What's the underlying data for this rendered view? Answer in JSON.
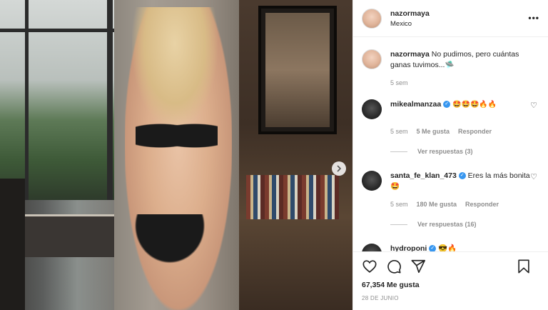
{
  "post": {
    "username": "nazormaya",
    "location": "Mexico",
    "more_label": "•••"
  },
  "caption": {
    "username": "nazormaya",
    "text": "No pudimos, pero cuántas ganas tuvimos...🛸",
    "time": "5 sem"
  },
  "comments": [
    {
      "username": "mikealmanzaa",
      "verified": true,
      "text": "🤩🤩🤩🔥🔥",
      "time": "5 sem",
      "likes": "5 Me gusta",
      "reply_label": "Responder",
      "view_replies": "Ver respuestas (3)"
    },
    {
      "username": "santa_fe_klan_473",
      "verified": true,
      "text": "Eres la más bonita 🤩",
      "time": "5 sem",
      "likes": "180 Me gusta",
      "reply_label": "Responder",
      "view_replies": "Ver respuestas (16)"
    },
    {
      "username": "hydroponi",
      "verified": true,
      "text": "😎🔥"
    }
  ],
  "footer": {
    "likes": "67,354 Me gusta",
    "date": "28 DE JUNIO"
  },
  "icons": {
    "verified": "✓",
    "heart": "♡",
    "next": "›"
  }
}
